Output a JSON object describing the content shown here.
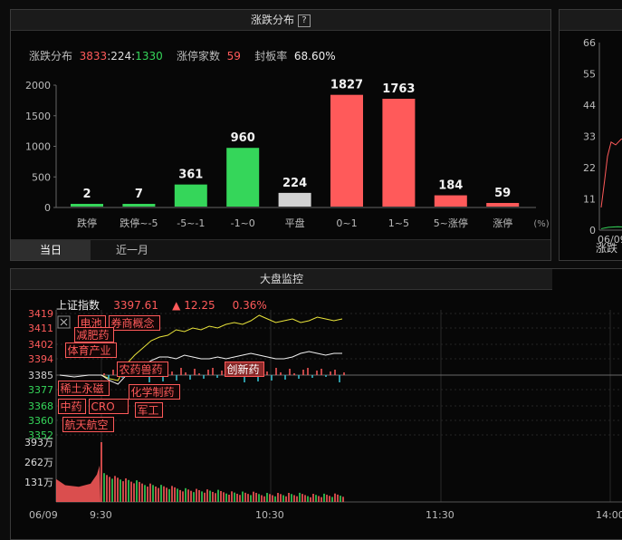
{
  "colors": {
    "up": "#ff5a5a",
    "down": "#35d65a",
    "flat": "#d2d2d2",
    "yellow": "#e8e23a",
    "white": "#f0f0f0",
    "cyan": "#39c6d6"
  },
  "dist_panel": {
    "title": "涨跌分布",
    "help": "?",
    "summary": {
      "label": "涨跌分布",
      "up": "3833",
      "sep1": ":",
      "flat": "224",
      "sep2": ":",
      "down": "1330",
      "limit_label": "涨停家数",
      "limit_value": "59",
      "seal_label": "封板率",
      "seal_value": "68.60%"
    },
    "pct_unit": "(%)",
    "tabs": [
      {
        "label": "当日",
        "active": true
      },
      {
        "label": "近一月",
        "active": false
      }
    ]
  },
  "monitor": {
    "title": "大盘监控",
    "index_name": "上证指数",
    "index_value": "3397.61",
    "arrow": "▲",
    "change": "12.25",
    "change_pct": "0.36%",
    "close_icon": "close-icon",
    "expand_icon": "expand-horizontal-icon"
  },
  "right_panel": {
    "label": "涨跌",
    "x_label": "06/09"
  },
  "chart_data": [
    {
      "type": "bar",
      "categories": [
        "跌停",
        "跌停~-5",
        "-5~-1",
        "-1~0",
        "平盘",
        "0~1",
        "1~5",
        "5~涨停",
        "涨停"
      ],
      "values": [
        2,
        7,
        361,
        960,
        224,
        1827,
        1763,
        184,
        59
      ],
      "ylim": [
        0,
        2000
      ],
      "yticks": [
        0,
        500,
        1000,
        1500,
        2000
      ],
      "value_labels": [
        "2",
        "7",
        "361",
        "960",
        "224",
        "1827",
        "1763",
        "184",
        "59"
      ]
    },
    {
      "type": "line",
      "y_ticks": [
        3419,
        3411,
        3402,
        3394,
        3385,
        3377,
        3368,
        3360,
        3352
      ],
      "ylim": [
        3352,
        3419
      ],
      "x_labels": [
        "06/09",
        "9:30",
        "10:30",
        "11:30",
        "14:00"
      ],
      "series": [
        {
          "values": [
            3385,
            3383,
            3382,
            3391,
            3396,
            3400,
            3404,
            3406,
            3407,
            3410,
            3409,
            3411,
            3410,
            3412,
            3411,
            3413,
            3414,
            3413,
            3415,
            3418,
            3416,
            3414,
            3415,
            3416,
            3414,
            3415,
            3417,
            3416,
            3415,
            3416
          ]
        },
        {
          "values": [
            3385,
            3382,
            3380,
            3385,
            3388,
            3390,
            3393,
            3395,
            3395,
            3394,
            3396,
            3395,
            3394,
            3394,
            3395,
            3394,
            3395,
            3396,
            3397,
            3396,
            3395,
            3394,
            3394,
            3395,
            3397,
            3398,
            3397,
            3396,
            3397,
            3397
          ]
        }
      ],
      "annotations": [
        "电池",
        "券商概念",
        "减肥药",
        "体育产业",
        "稀土永磁",
        "农药兽药",
        "化学制药",
        "中药",
        "CRO",
        "军工",
        "航天航空",
        "创新药"
      ]
    },
    {
      "type": "bar",
      "y_ticks": [
        "393万",
        "262万",
        "131万"
      ],
      "ylim": [
        0,
        393
      ]
    },
    {
      "type": "line",
      "y_ticks": [
        66,
        55,
        44,
        33,
        22,
        11,
        0
      ],
      "ylim": [
        0,
        66
      ]
    }
  ]
}
